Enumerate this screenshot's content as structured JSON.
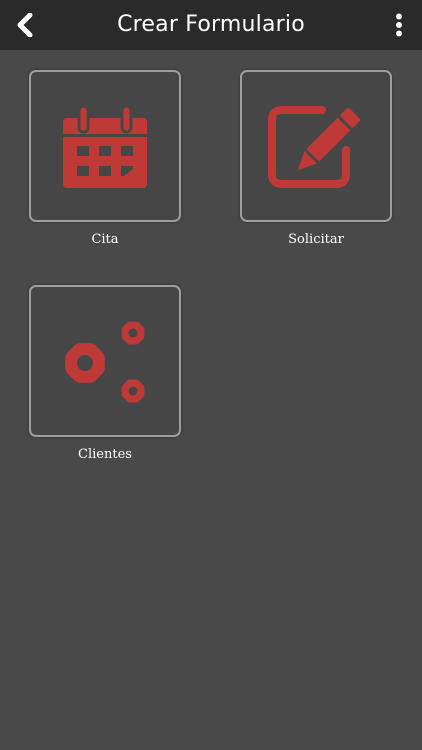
{
  "header": {
    "title": "Crear Formulario",
    "back_icon": "chevron-left-icon",
    "menu_icon": "more-vertical-icon"
  },
  "tiles": [
    {
      "label": "Cita",
      "icon": "calendar-icon"
    },
    {
      "label": "Solicitar",
      "icon": "edit-icon"
    },
    {
      "label": "Clientes",
      "icon": "gears-icon"
    }
  ],
  "colors": {
    "background": "#4a4949",
    "header": "#2a2a2a",
    "accent": "#bf3a37",
    "tile_border": "#9e9e9e",
    "text": "#ffffff"
  }
}
